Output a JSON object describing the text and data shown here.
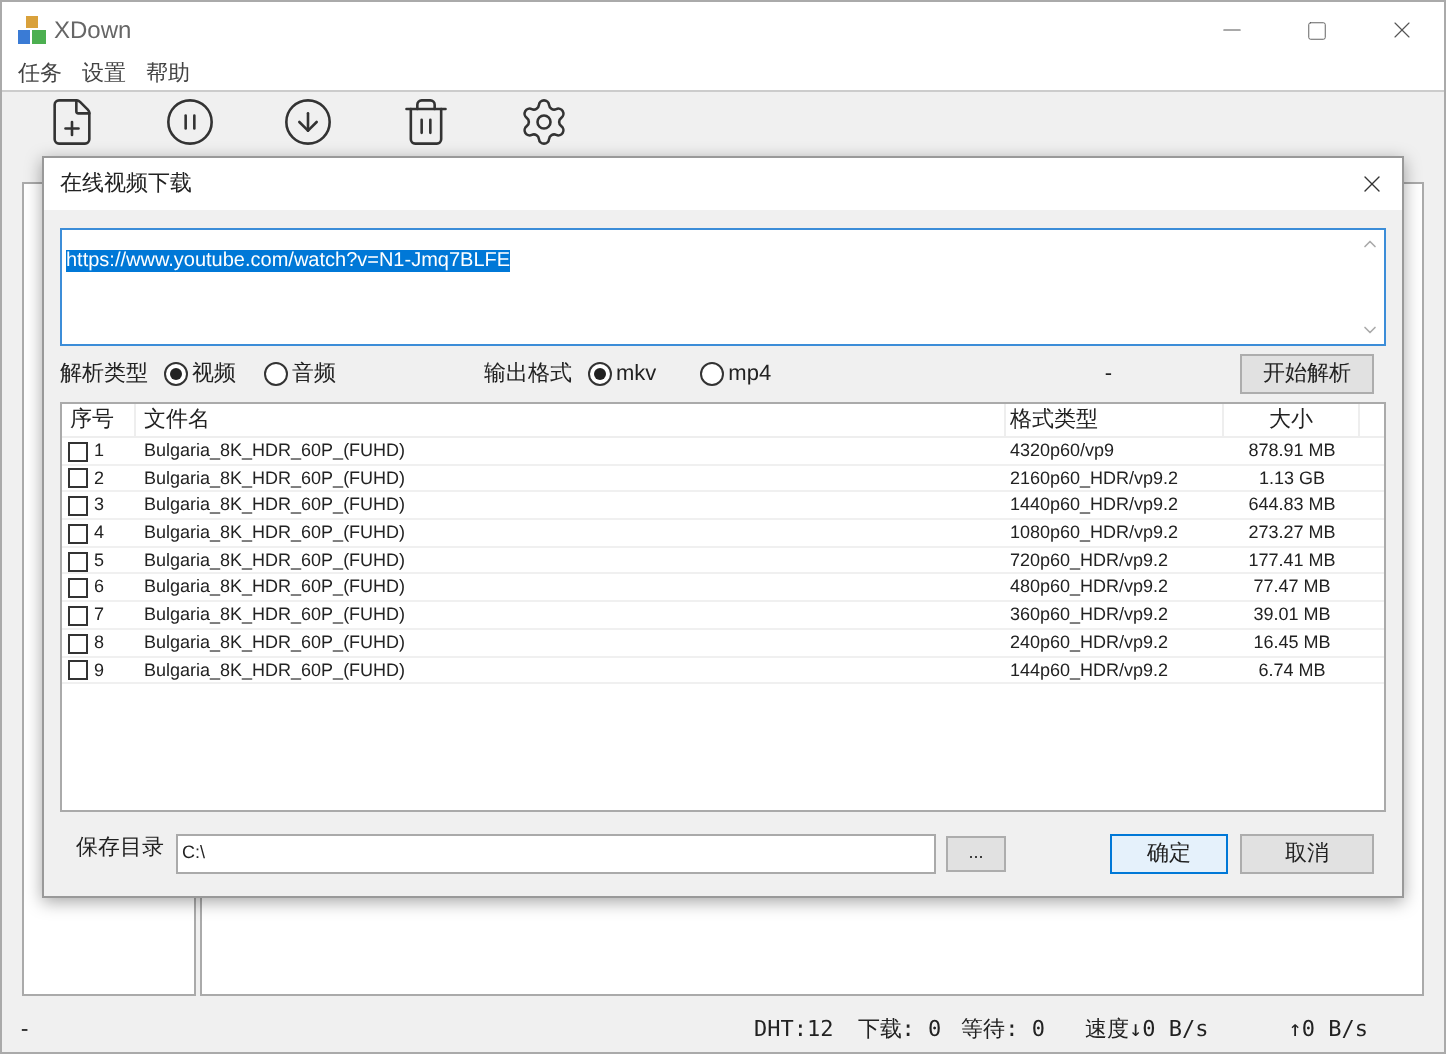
{
  "window": {
    "title": "XDown"
  },
  "menu": [
    "任务",
    "设置",
    "帮助"
  ],
  "toolbar": [
    {
      "kind": "new"
    },
    {
      "kind": "pause"
    },
    {
      "kind": "resume"
    },
    {
      "kind": "delete"
    },
    {
      "kind": "settings"
    }
  ],
  "dialog": {
    "title": "在线视频下载",
    "url": "https://www.youtube.com/watch?v=N1-Jmq7BLFE",
    "parse_type": {
      "label": "解析类型",
      "options": [
        {
          "label": "视频",
          "selected": true
        },
        {
          "label": "音频",
          "selected": false
        }
      ]
    },
    "output_format": {
      "label": "输出格式",
      "options": [
        {
          "label": "mkv",
          "selected": true
        },
        {
          "label": "mp4",
          "selected": false
        }
      ]
    },
    "status": "-",
    "parse_button": "开始解析",
    "table": {
      "columns": [
        "序号",
        "文件名",
        "格式类型",
        "大小"
      ],
      "rows": [
        {
          "index": "1",
          "name": "Bulgaria_8K_HDR_60P_(FUHD)",
          "format": "4320p60/vp9",
          "size": "878.91 MB",
          "checked": false
        },
        {
          "index": "2",
          "name": "Bulgaria_8K_HDR_60P_(FUHD)",
          "format": "2160p60_HDR/vp9.2",
          "size": "1.13 GB",
          "checked": false
        },
        {
          "index": "3",
          "name": "Bulgaria_8K_HDR_60P_(FUHD)",
          "format": "1440p60_HDR/vp9.2",
          "size": "644.83 MB",
          "checked": false
        },
        {
          "index": "4",
          "name": "Bulgaria_8K_HDR_60P_(FUHD)",
          "format": "1080p60_HDR/vp9.2",
          "size": "273.27 MB",
          "checked": false
        },
        {
          "index": "5",
          "name": "Bulgaria_8K_HDR_60P_(FUHD)",
          "format": "720p60_HDR/vp9.2",
          "size": "177.41 MB",
          "checked": false
        },
        {
          "index": "6",
          "name": "Bulgaria_8K_HDR_60P_(FUHD)",
          "format": "480p60_HDR/vp9.2",
          "size": "77.47 MB",
          "checked": false
        },
        {
          "index": "7",
          "name": "Bulgaria_8K_HDR_60P_(FUHD)",
          "format": "360p60_HDR/vp9.2",
          "size": "39.01 MB",
          "checked": false
        },
        {
          "index": "8",
          "name": "Bulgaria_8K_HDR_60P_(FUHD)",
          "format": "240p60_HDR/vp9.2",
          "size": "16.45 MB",
          "checked": false
        },
        {
          "index": "9",
          "name": "Bulgaria_8K_HDR_60P_(FUHD)",
          "format": "144p60_HDR/vp9.2",
          "size": "6.74 MB",
          "checked": false
        }
      ]
    },
    "save_label": "保存目录",
    "save_path": "C:\\",
    "browse_button": "...",
    "ok_button": "确定",
    "cancel_button": "取消"
  },
  "status_bar": {
    "left": "-",
    "dht": "DHT:12",
    "downloading": "下载: 0",
    "waiting": "等待: 0",
    "speed_down": "速度↓0 B/s",
    "speed_up": "↑0 B/s"
  }
}
